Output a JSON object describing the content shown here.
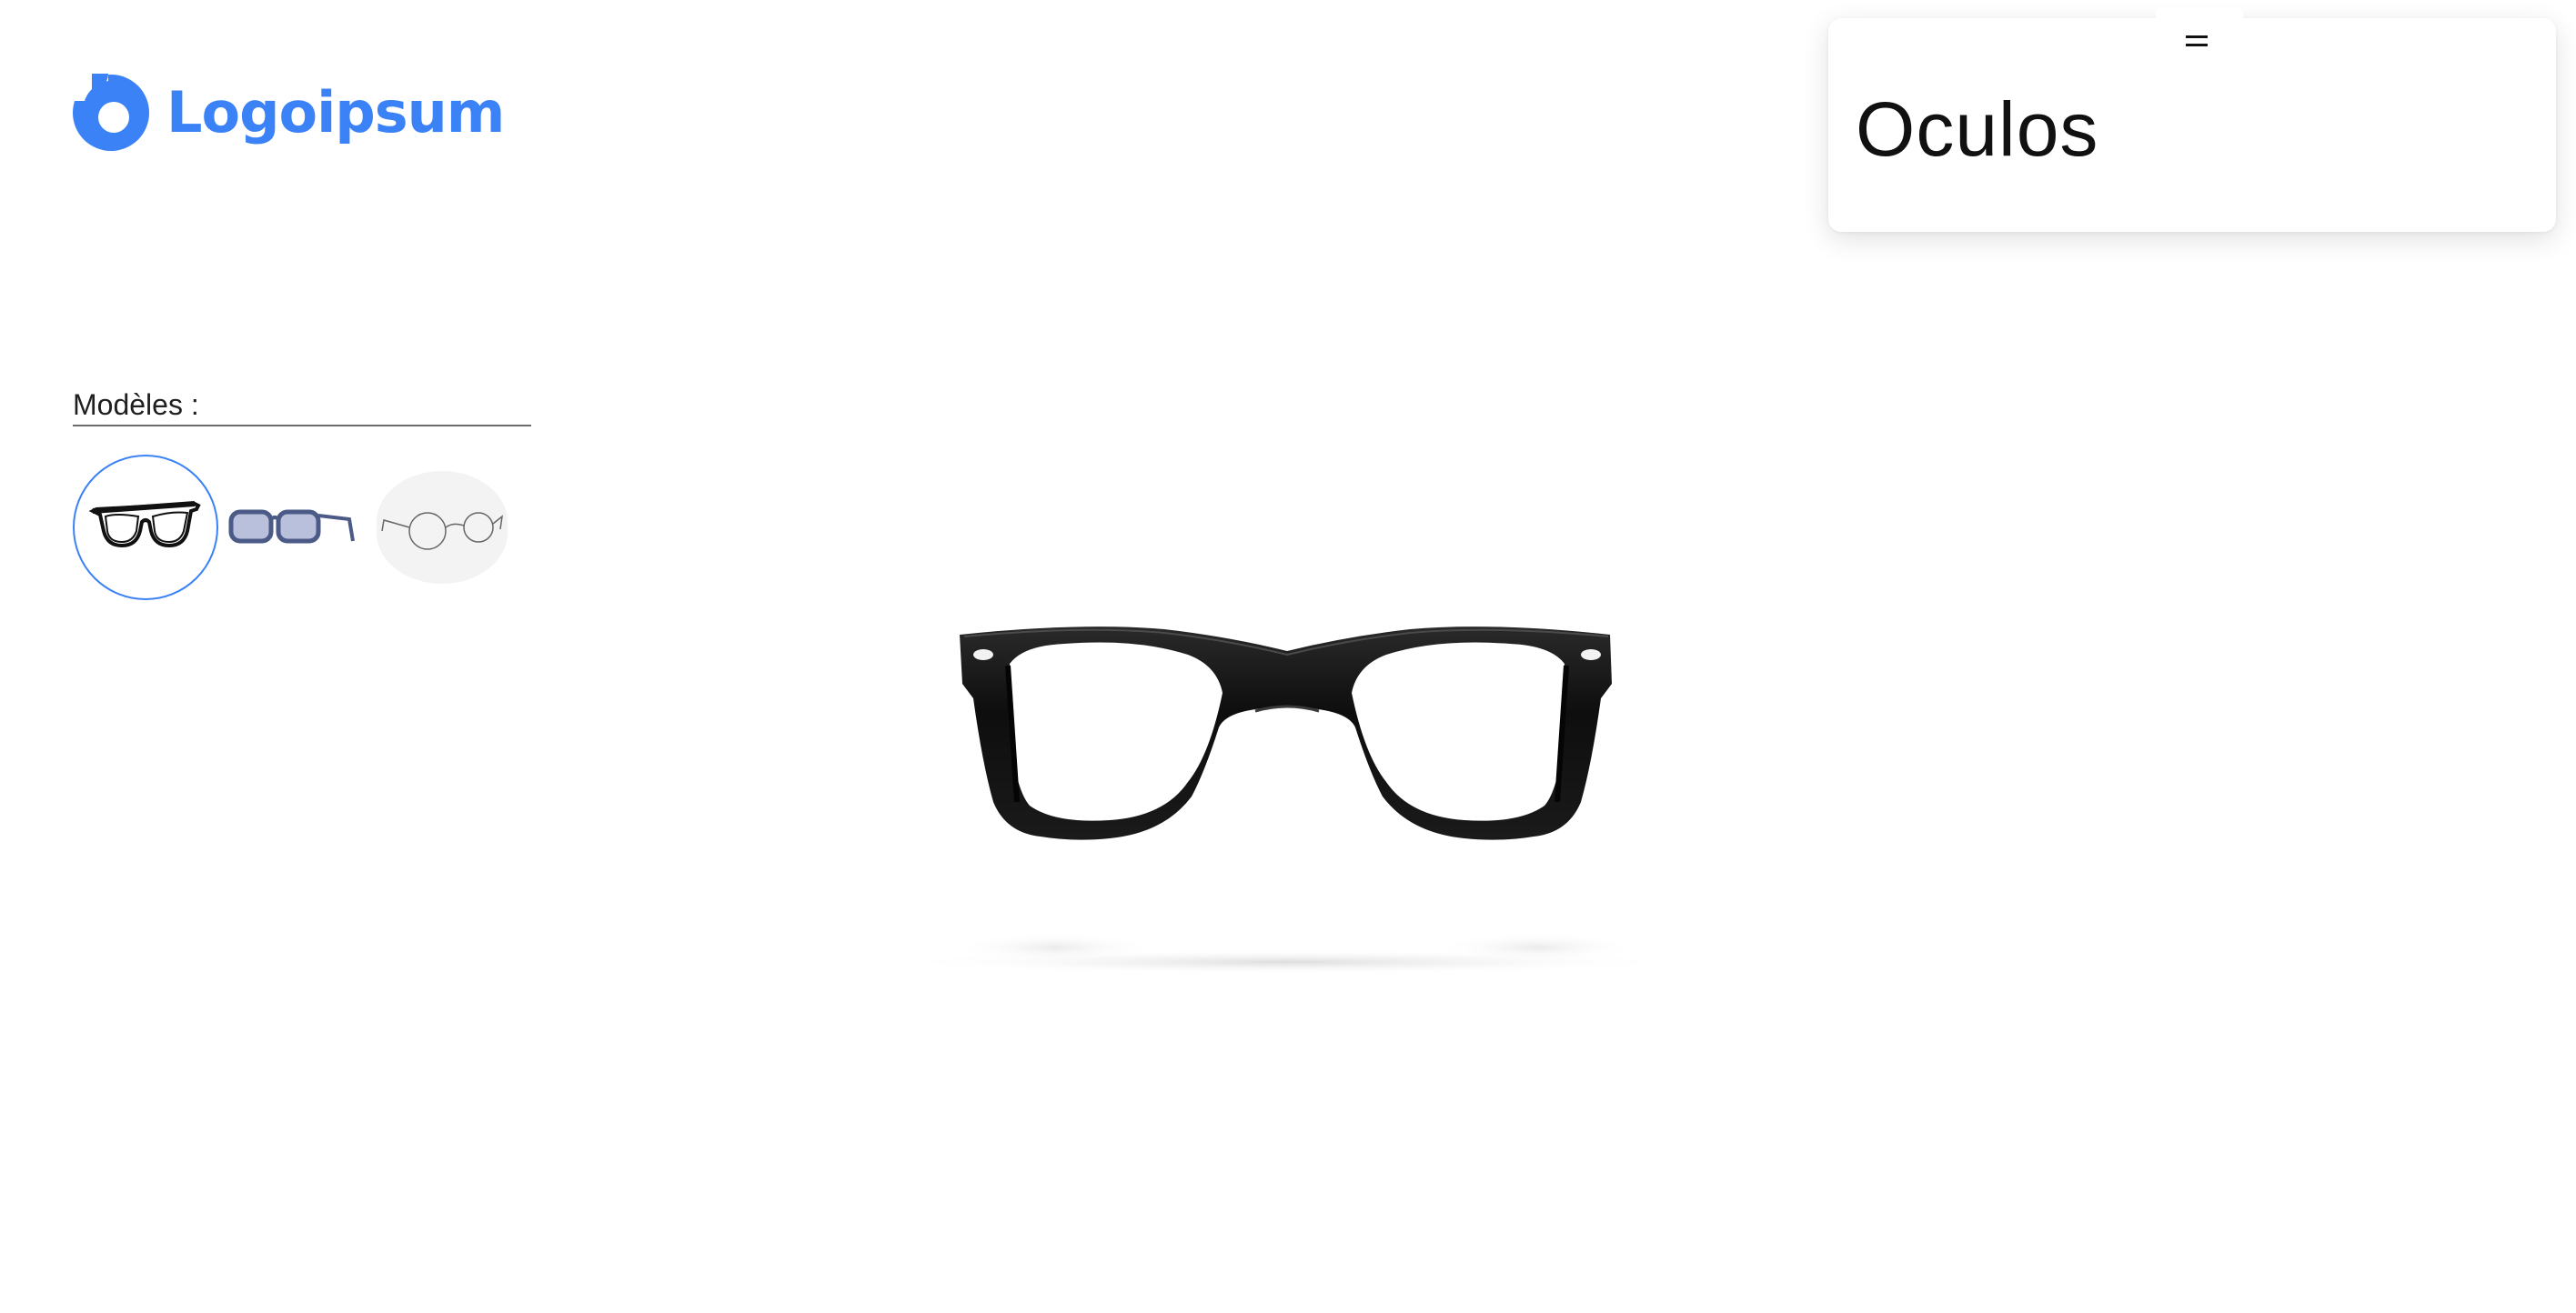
{
  "brand": {
    "name": "Logoipsum",
    "color": "#3b82f6"
  },
  "models": {
    "label": "Modèles :",
    "items": [
      {
        "icon": "black-wayfarer-glasses-icon",
        "selected": true
      },
      {
        "icon": "blue-rectangle-glasses-icon",
        "selected": false
      },
      {
        "icon": "wire-round-glasses-icon",
        "selected": false
      }
    ]
  },
  "panel": {
    "title": "Oculos",
    "menu_icon": "hamburger-menu-icon"
  },
  "viewer": {
    "model_icon": "black-wayfarer-glasses-3d"
  },
  "colors": {
    "accent": "#3b82f6",
    "frame": "#111111",
    "blue_frame": "#4b5a86"
  }
}
